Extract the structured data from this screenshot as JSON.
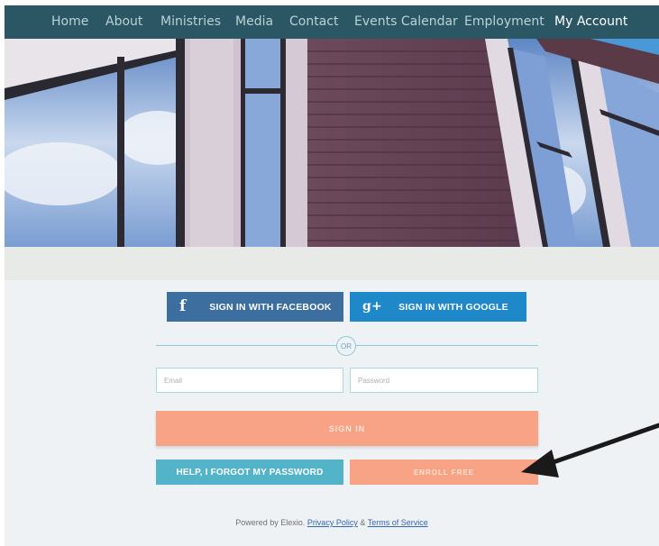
{
  "nav": {
    "items": [
      {
        "label": "Home"
      },
      {
        "label": "About"
      },
      {
        "label": "Ministries"
      },
      {
        "label": "Media"
      },
      {
        "label": "Contact"
      },
      {
        "label": "Events Calendar"
      },
      {
        "label": "Employment"
      },
      {
        "label": "My Account",
        "active": true
      }
    ]
  },
  "login": {
    "facebook_label": "SIGN IN WITH FACEBOOK",
    "facebook_icon": "f",
    "google_label": "SIGN IN WITH GOOGLE",
    "google_icon": "g+",
    "or_label": "OR",
    "email_placeholder": "Email",
    "password_placeholder": "Password",
    "signin_label": "SIGN IN",
    "forgot_label": "HELP, I FORGOT MY PASSWORD",
    "enroll_label": "ENROLL FREE"
  },
  "footer": {
    "powered_by": "Powered by Elexio.",
    "privacy_label": "Privacy Policy",
    "and": "&",
    "terms_label": "Terms of Service"
  },
  "colors": {
    "nav_bg": "#2a5763",
    "facebook": "#3c6ea0",
    "google": "#1e88c8",
    "signin": "#f8a386",
    "forgot": "#53b3c9"
  }
}
